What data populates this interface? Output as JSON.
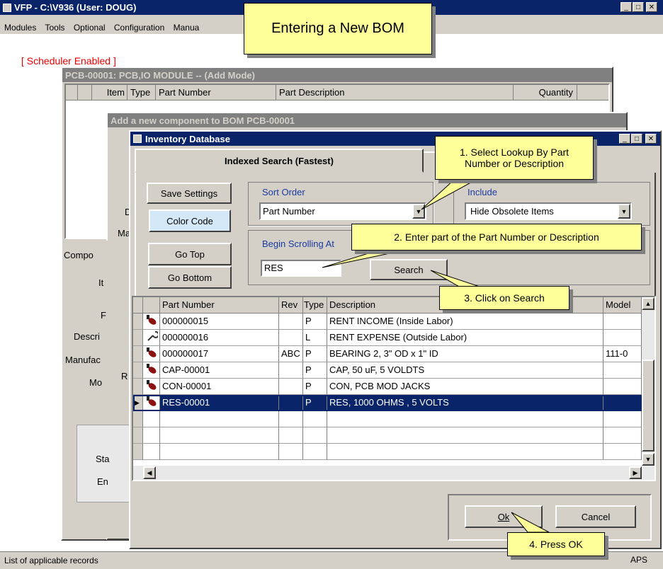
{
  "main_window": {
    "title": "VFP - C:\\V936  (User: DOUG)",
    "menu": [
      "Modules",
      "Tools",
      "Optional",
      "Configuration",
      "Manua"
    ],
    "scheduler": "[ Scheduler Enabled ]",
    "status": "List of applicable records",
    "status_right": "APS"
  },
  "banner": "Entering a New BOM",
  "bom_window": {
    "title": "PCB-00001: PCB,IO MODULE -- (Add Mode)",
    "columns": [
      "Item",
      "Type",
      "Part Number",
      "Part Description",
      "Quantity"
    ]
  },
  "add_window": {
    "title": "Add a new component to BOM PCB-00001",
    "labels": [
      "Compo",
      "It",
      "F",
      "Descri",
      "Manufac",
      "Mo",
      "Sta",
      "En",
      "D",
      "Ma",
      "R"
    ]
  },
  "inventory": {
    "title": "Inventory Database",
    "tab_active": "Indexed Search  (Fastest)",
    "save_settings": "Save Settings",
    "color_code": "Color Code",
    "go_top": "Go Top",
    "go_bottom": "Go Bottom",
    "sort_order_label": "Sort Order",
    "sort_order_value": "Part Number",
    "include_label": "Include",
    "include_value": "Hide Obsolete Items",
    "begin_label": "Begin Scrolling At",
    "begin_value": "RES",
    "search": "Search",
    "columns": [
      "Part Number",
      "Rev",
      "Type",
      "Description",
      "Model"
    ],
    "rows": [
      {
        "part": "000000015",
        "rev": "",
        "type": "P",
        "desc": "RENT INCOME (Inside Labor)",
        "model": "",
        "icon": "part-icon"
      },
      {
        "part": "000000016",
        "rev": "",
        "type": "L",
        "desc": "RENT EXPENSE (Outside Labor)",
        "model": "",
        "icon": "wrench-icon"
      },
      {
        "part": "000000017",
        "rev": "ABC",
        "type": "P",
        "desc": "BEARING 2, 3\" OD x 1\" ID",
        "model": "111-0",
        "icon": "part-icon"
      },
      {
        "part": "CAP-00001",
        "rev": "",
        "type": "P",
        "desc": "CAP, 50 uF, 5 VOLDTS",
        "model": "",
        "icon": "part-icon"
      },
      {
        "part": "CON-00001",
        "rev": "",
        "type": "P",
        "desc": "CON,  PCB MOD  JACKS",
        "model": "",
        "icon": "part-icon"
      },
      {
        "part": "RES-00001",
        "rev": "",
        "type": "P",
        "desc": "RES, 1000 OHMS , 5 VOLTS",
        "model": "",
        "icon": "part-icon"
      }
    ],
    "ok": "Ok",
    "cancel": "Cancel"
  },
  "callouts": {
    "c1": "1. Select Lookup By Part Number or Description",
    "c2": "2. Enter part of the Part Number or Description",
    "c3": "3. Click on Search",
    "c4": "4. Press OK"
  }
}
